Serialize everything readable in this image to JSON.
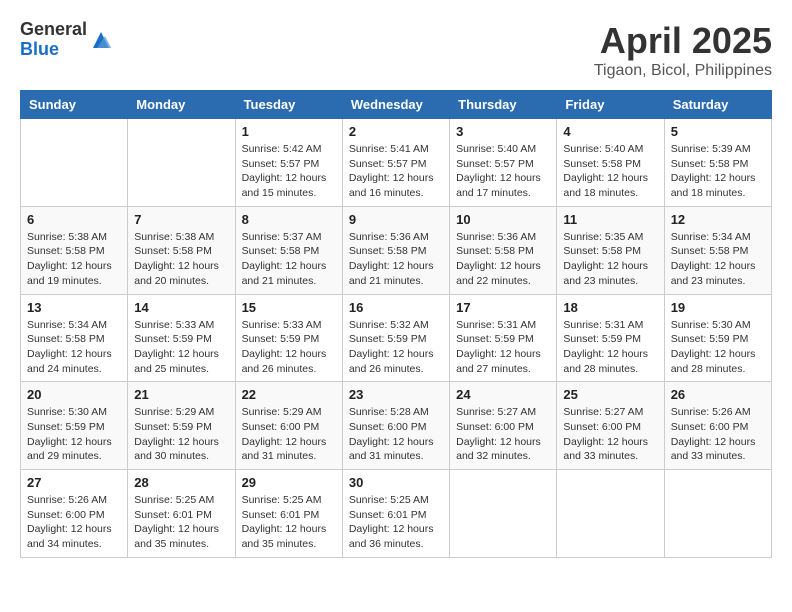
{
  "logo": {
    "general": "General",
    "blue": "Blue"
  },
  "title": "April 2025",
  "subtitle": "Tigaon, Bicol, Philippines",
  "days_of_week": [
    "Sunday",
    "Monday",
    "Tuesday",
    "Wednesday",
    "Thursday",
    "Friday",
    "Saturday"
  ],
  "weeks": [
    [
      null,
      null,
      {
        "day": "1",
        "sunrise": "5:42 AM",
        "sunset": "5:57 PM",
        "daylight": "12 hours and 15 minutes."
      },
      {
        "day": "2",
        "sunrise": "5:41 AM",
        "sunset": "5:57 PM",
        "daylight": "12 hours and 16 minutes."
      },
      {
        "day": "3",
        "sunrise": "5:40 AM",
        "sunset": "5:57 PM",
        "daylight": "12 hours and 17 minutes."
      },
      {
        "day": "4",
        "sunrise": "5:40 AM",
        "sunset": "5:58 PM",
        "daylight": "12 hours and 18 minutes."
      },
      {
        "day": "5",
        "sunrise": "5:39 AM",
        "sunset": "5:58 PM",
        "daylight": "12 hours and 18 minutes."
      }
    ],
    [
      {
        "day": "6",
        "sunrise": "5:38 AM",
        "sunset": "5:58 PM",
        "daylight": "12 hours and 19 minutes."
      },
      {
        "day": "7",
        "sunrise": "5:38 AM",
        "sunset": "5:58 PM",
        "daylight": "12 hours and 20 minutes."
      },
      {
        "day": "8",
        "sunrise": "5:37 AM",
        "sunset": "5:58 PM",
        "daylight": "12 hours and 21 minutes."
      },
      {
        "day": "9",
        "sunrise": "5:36 AM",
        "sunset": "5:58 PM",
        "daylight": "12 hours and 21 minutes."
      },
      {
        "day": "10",
        "sunrise": "5:36 AM",
        "sunset": "5:58 PM",
        "daylight": "12 hours and 22 minutes."
      },
      {
        "day": "11",
        "sunrise": "5:35 AM",
        "sunset": "5:58 PM",
        "daylight": "12 hours and 23 minutes."
      },
      {
        "day": "12",
        "sunrise": "5:34 AM",
        "sunset": "5:58 PM",
        "daylight": "12 hours and 23 minutes."
      }
    ],
    [
      {
        "day": "13",
        "sunrise": "5:34 AM",
        "sunset": "5:58 PM",
        "daylight": "12 hours and 24 minutes."
      },
      {
        "day": "14",
        "sunrise": "5:33 AM",
        "sunset": "5:59 PM",
        "daylight": "12 hours and 25 minutes."
      },
      {
        "day": "15",
        "sunrise": "5:33 AM",
        "sunset": "5:59 PM",
        "daylight": "12 hours and 26 minutes."
      },
      {
        "day": "16",
        "sunrise": "5:32 AM",
        "sunset": "5:59 PM",
        "daylight": "12 hours and 26 minutes."
      },
      {
        "day": "17",
        "sunrise": "5:31 AM",
        "sunset": "5:59 PM",
        "daylight": "12 hours and 27 minutes."
      },
      {
        "day": "18",
        "sunrise": "5:31 AM",
        "sunset": "5:59 PM",
        "daylight": "12 hours and 28 minutes."
      },
      {
        "day": "19",
        "sunrise": "5:30 AM",
        "sunset": "5:59 PM",
        "daylight": "12 hours and 28 minutes."
      }
    ],
    [
      {
        "day": "20",
        "sunrise": "5:30 AM",
        "sunset": "5:59 PM",
        "daylight": "12 hours and 29 minutes."
      },
      {
        "day": "21",
        "sunrise": "5:29 AM",
        "sunset": "5:59 PM",
        "daylight": "12 hours and 30 minutes."
      },
      {
        "day": "22",
        "sunrise": "5:29 AM",
        "sunset": "6:00 PM",
        "daylight": "12 hours and 31 minutes."
      },
      {
        "day": "23",
        "sunrise": "5:28 AM",
        "sunset": "6:00 PM",
        "daylight": "12 hours and 31 minutes."
      },
      {
        "day": "24",
        "sunrise": "5:27 AM",
        "sunset": "6:00 PM",
        "daylight": "12 hours and 32 minutes."
      },
      {
        "day": "25",
        "sunrise": "5:27 AM",
        "sunset": "6:00 PM",
        "daylight": "12 hours and 33 minutes."
      },
      {
        "day": "26",
        "sunrise": "5:26 AM",
        "sunset": "6:00 PM",
        "daylight": "12 hours and 33 minutes."
      }
    ],
    [
      {
        "day": "27",
        "sunrise": "5:26 AM",
        "sunset": "6:00 PM",
        "daylight": "12 hours and 34 minutes."
      },
      {
        "day": "28",
        "sunrise": "5:25 AM",
        "sunset": "6:01 PM",
        "daylight": "12 hours and 35 minutes."
      },
      {
        "day": "29",
        "sunrise": "5:25 AM",
        "sunset": "6:01 PM",
        "daylight": "12 hours and 35 minutes."
      },
      {
        "day": "30",
        "sunrise": "5:25 AM",
        "sunset": "6:01 PM",
        "daylight": "12 hours and 36 minutes."
      },
      null,
      null,
      null
    ]
  ]
}
